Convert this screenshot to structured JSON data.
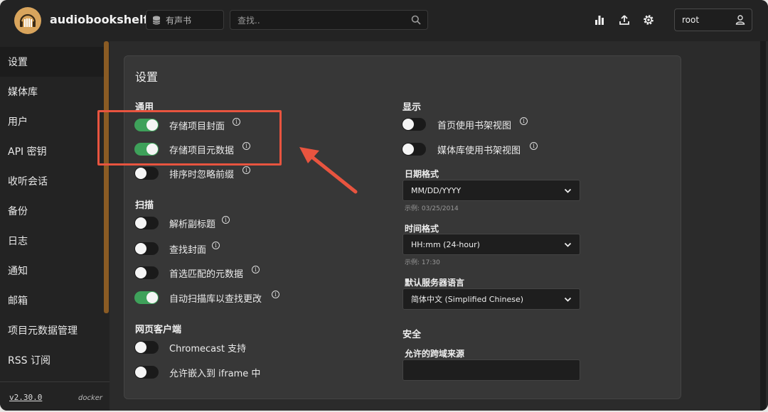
{
  "header": {
    "app_title": "audiobookshelf",
    "library_select": "有声书",
    "search_placeholder": "查找..",
    "user": "root"
  },
  "sidebar": {
    "items": [
      {
        "label": "设置",
        "active": true
      },
      {
        "label": "媒体库"
      },
      {
        "label": "用户"
      },
      {
        "label": "API 密钥"
      },
      {
        "label": "收听会话"
      },
      {
        "label": "备份"
      },
      {
        "label": "日志"
      },
      {
        "label": "通知"
      },
      {
        "label": "邮箱"
      },
      {
        "label": "项目元数据管理"
      },
      {
        "label": "RSS 订阅"
      }
    ],
    "version": "v2.30.0",
    "env": "docker"
  },
  "settings": {
    "title": "设置",
    "general": {
      "heading": "通用",
      "options": [
        {
          "label": "存储项目封面",
          "on": true
        },
        {
          "label": "存储项目元数据",
          "on": true
        },
        {
          "label": "排序时忽略前缀",
          "on": false
        }
      ]
    },
    "scan": {
      "heading": "扫描",
      "options": [
        {
          "label": "解析副标题",
          "on": false
        },
        {
          "label": "查找封面",
          "on": false
        },
        {
          "label": "首选匹配的元数据",
          "on": false
        },
        {
          "label": "自动扫描库以查找更改",
          "on": true
        }
      ]
    },
    "web_client": {
      "heading": "网页客户端",
      "options": [
        {
          "label": "Chromecast 支持",
          "on": false
        },
        {
          "label": "允许嵌入到 iframe 中",
          "on": false
        }
      ]
    },
    "display": {
      "heading": "显示",
      "options": [
        {
          "label": "首页使用书架视图",
          "on": false
        },
        {
          "label": "媒体库使用书架视图",
          "on": false
        }
      ],
      "date_format": {
        "label": "日期格式",
        "value": "MM/DD/YYYY",
        "example": "示例: 03/25/2014"
      },
      "time_format": {
        "label": "时间格式",
        "value": "HH:mm (24-hour)",
        "example": "示例: 17:30"
      },
      "language": {
        "label": "默认服务器语言",
        "value": "简体中文 (Simplified Chinese)"
      }
    },
    "security": {
      "heading": "安全",
      "cors_label": "允许的跨域来源",
      "cors_value": ""
    }
  },
  "colors": {
    "toggle_on": "#3ea15a",
    "annotation": "#e8543f",
    "scrollbar": "#8a5b24"
  }
}
